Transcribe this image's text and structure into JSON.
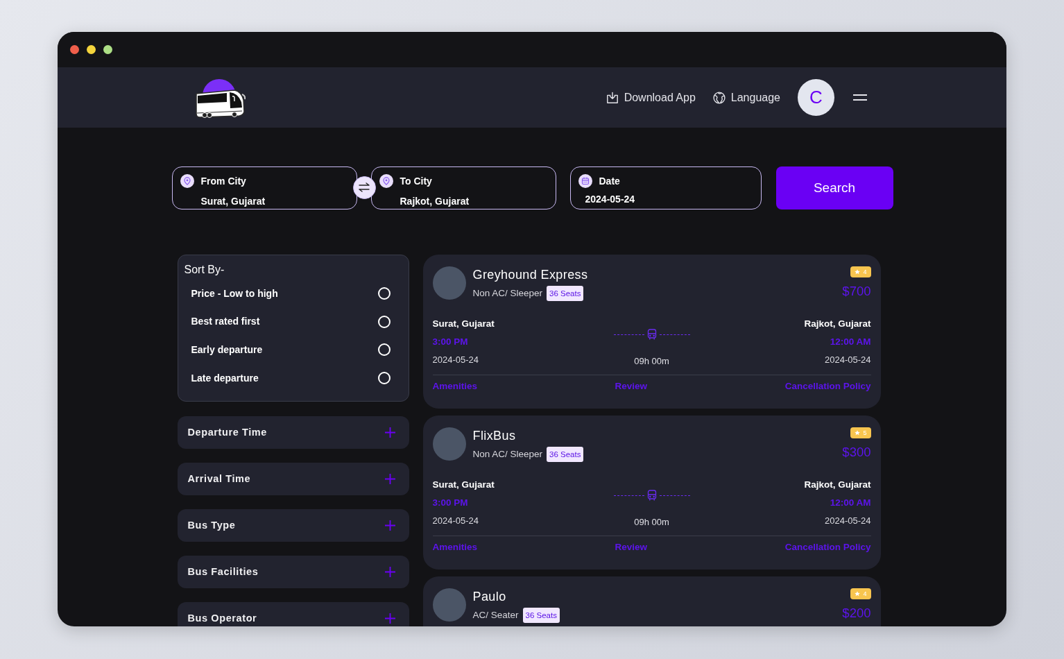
{
  "window_controls": [
    {
      "color": "#f05f4b"
    },
    {
      "color": "#f4d43c"
    },
    {
      "color": "#addf86"
    }
  ],
  "header": {
    "links": [
      {
        "label": "Download App"
      },
      {
        "label": "Language"
      }
    ],
    "avatar": "C"
  },
  "search": {
    "fields": [
      {
        "kind": "city",
        "label": "From City",
        "value": "Surat, Gujarat"
      },
      {
        "kind": "city",
        "label": "To City",
        "value": "Rajkot, Gujarat"
      },
      {
        "kind": "date",
        "label": "Date",
        "value": "2024-05-24"
      }
    ],
    "button": "Search"
  },
  "sort": {
    "title": "Sort By-",
    "options": [
      {
        "label": "Price - Low to high",
        "selected": false
      },
      {
        "label": "Best rated first",
        "selected": false
      },
      {
        "label": "Early departure",
        "selected": false
      },
      {
        "label": "Late departure",
        "selected": false
      }
    ]
  },
  "filters": [
    {
      "label": "Departure Time",
      "expanded": false
    },
    {
      "label": "Arrival Time",
      "expanded": false
    },
    {
      "label": "Bus Type",
      "expanded": false
    },
    {
      "label": "Bus Facilities",
      "expanded": false
    },
    {
      "label": "Bus Operator",
      "expanded": false
    }
  ],
  "results": [
    {
      "operator": "Greyhound Express",
      "bus_type": "Non AC/ Sleeper",
      "seats": "36 Seats",
      "rating": "4",
      "price": "$700",
      "departure": {
        "city": "Surat, Gujarat",
        "time": "3:00 PM",
        "date": "2024-05-24"
      },
      "arrival": {
        "city": "Rajkot, Gujarat",
        "time": "12:00 AM",
        "date": "2024-05-24"
      },
      "duration": "09h 00m",
      "links": [
        "Amenities",
        "Review",
        "Cancellation Policy"
      ]
    },
    {
      "operator": "FlixBus",
      "bus_type": "Non AC/ Sleeper",
      "seats": "36 Seats",
      "rating": "5",
      "price": "$300",
      "departure": {
        "city": "Surat, Gujarat",
        "time": "3:00 PM",
        "date": "2024-05-24"
      },
      "arrival": {
        "city": "Rajkot, Gujarat",
        "time": "12:00 AM",
        "date": "2024-05-24"
      },
      "duration": "09h 00m",
      "links": [
        "Amenities",
        "Review",
        "Cancellation Policy"
      ]
    },
    {
      "operator": "Paulo",
      "bus_type": "AC/ Seater",
      "seats": "36 Seats",
      "rating": "4",
      "price": "$200"
    }
  ]
}
